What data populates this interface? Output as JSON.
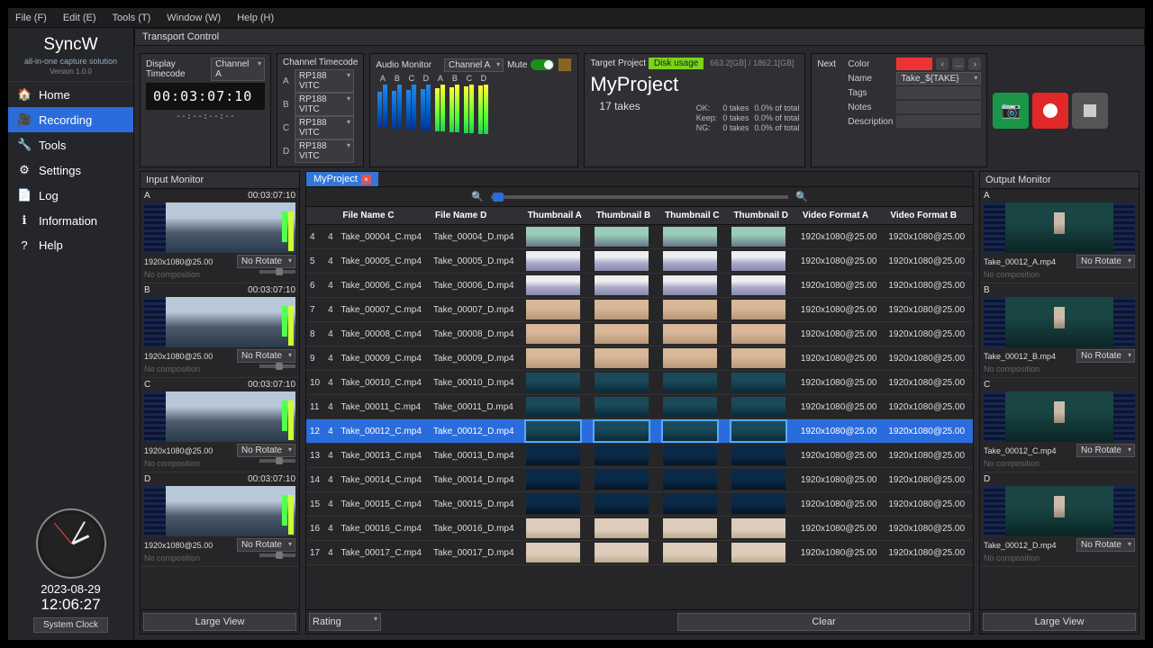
{
  "menu": [
    "File (F)",
    "Edit (E)",
    "Tools (T)",
    "Window (W)",
    "Help (H)"
  ],
  "brand": {
    "title": "SyncW",
    "sub": "all-in-one capture solution",
    "ver": "Version 1.0.0"
  },
  "nav": [
    {
      "label": "Home",
      "icon": "⮕",
      "glyph": "🏠"
    },
    {
      "label": "Recording",
      "icon": "🎥",
      "active": true
    },
    {
      "label": "Tools",
      "icon": "🔧"
    },
    {
      "label": "Settings",
      "icon": "⚙"
    },
    {
      "label": "Log",
      "icon": "📄"
    },
    {
      "label": "Information",
      "icon": "ℹ"
    },
    {
      "label": "Help",
      "icon": "?"
    }
  ],
  "clock": {
    "date": "2023-08-29",
    "time": "12:06:27",
    "btn": "System Clock"
  },
  "transport": {
    "hdr": "Transport Control"
  },
  "displayTC": {
    "label": "Display Timecode",
    "sel": "Channel A",
    "big": "00:03:07:10",
    "small": "--:--:--:--"
  },
  "chanTC": {
    "label": "Channel Timecode",
    "rows": [
      [
        "A",
        "RP188 VITC"
      ],
      [
        "B",
        "RP188 VITC"
      ],
      [
        "C",
        "RP188 VITC"
      ],
      [
        "D",
        "RP188 VITC"
      ]
    ]
  },
  "audio": {
    "label": "Audio Monitor",
    "sel": "Channel A",
    "mute": "Mute",
    "groups": [
      "A",
      "B",
      "C",
      "D",
      "A",
      "B",
      "C",
      "D"
    ]
  },
  "target": {
    "label": "Target Project",
    "disk": "Disk usage",
    "disktxt": "663.2[GB] / 1862.1[GB]",
    "name": "MyProject",
    "takes": "17 takes",
    "lbls": [
      "OK:",
      "Keep:",
      "NG:"
    ],
    "vals": [
      "0 takes",
      "0 takes",
      "0 takes"
    ],
    "pcts": [
      "0.0% of total",
      "0.0% of total",
      "0.0% of total"
    ]
  },
  "next": {
    "hdr": "Next",
    "fields": {
      "color": "Color",
      "name": "Name",
      "nameval": "Take_${TAKE}",
      "tags": "Tags",
      "notes": "Notes",
      "desc": "Description"
    }
  },
  "inputMon": {
    "hdr": "Input Monitor",
    "large": "Large View",
    "channels": [
      {
        "ch": "A",
        "tc": "00:03:07:10",
        "res": "1920x1080@25.00",
        "rot": "No Rotate",
        "comp": "No composition"
      },
      {
        "ch": "B",
        "tc": "00:03:07:10",
        "res": "1920x1080@25.00",
        "rot": "No Rotate",
        "comp": "No composition"
      },
      {
        "ch": "C",
        "tc": "00:03:07:10",
        "res": "1920x1080@25.00",
        "rot": "No Rotate",
        "comp": "No composition"
      },
      {
        "ch": "D",
        "tc": "00:03:07:10",
        "res": "1920x1080@25.00",
        "rot": "No Rotate",
        "comp": "No composition"
      }
    ]
  },
  "outputMon": {
    "hdr": "Output Monitor",
    "large": "Large View",
    "channels": [
      {
        "ch": "A",
        "file": "Take_00012_A.mp4",
        "rot": "No Rotate",
        "comp": "No composition"
      },
      {
        "ch": "B",
        "file": "Take_00012_B.mp4",
        "rot": "No Rotate",
        "comp": "No composition"
      },
      {
        "ch": "C",
        "file": "Take_00012_C.mp4",
        "rot": "No Rotate",
        "comp": "No composition"
      },
      {
        "ch": "D",
        "file": "Take_00012_D.mp4",
        "rot": "No Rotate",
        "comp": "No composition"
      }
    ]
  },
  "table": {
    "tab": "MyProject",
    "headers": [
      "",
      "",
      "File Name C",
      "File Name D",
      "Thumbnail A",
      "Thumbnail B",
      "Thumbnail C",
      "Thumbnail D",
      "Video Format A",
      "Video Format B"
    ],
    "rows": [
      {
        "n": 4,
        "r": 4,
        "fc": "Take_00004_C.mp4",
        "fd": "Take_00004_D.mp4",
        "th": "th-sky",
        "va": "1920x1080@25.00",
        "vb": "1920x1080@25.00"
      },
      {
        "n": 5,
        "r": 4,
        "fc": "Take_00005_C.mp4",
        "fd": "Take_00005_D.mp4",
        "th": "th-snow",
        "va": "1920x1080@25.00",
        "vb": "1920x1080@25.00"
      },
      {
        "n": 6,
        "r": 4,
        "fc": "Take_00006_C.mp4",
        "fd": "Take_00006_D.mp4",
        "th": "th-snow",
        "va": "1920x1080@25.00",
        "vb": "1920x1080@25.00"
      },
      {
        "n": 7,
        "r": 4,
        "fc": "Take_00007_C.mp4",
        "fd": "Take_00007_D.mp4",
        "th": "th-face",
        "va": "1920x1080@25.00",
        "vb": "1920x1080@25.00"
      },
      {
        "n": 8,
        "r": 4,
        "fc": "Take_00008_C.mp4",
        "fd": "Take_00008_D.mp4",
        "th": "th-face",
        "va": "1920x1080@25.00",
        "vb": "1920x1080@25.00"
      },
      {
        "n": 9,
        "r": 4,
        "fc": "Take_00009_C.mp4",
        "fd": "Take_00009_D.mp4",
        "th": "th-face",
        "va": "1920x1080@25.00",
        "vb": "1920x1080@25.00"
      },
      {
        "n": 10,
        "r": 4,
        "fc": "Take_00010_C.mp4",
        "fd": "Take_00010_D.mp4",
        "th": "th-div",
        "va": "1920x1080@25.00",
        "vb": "1920x1080@25.00"
      },
      {
        "n": 11,
        "r": 4,
        "fc": "Take_00011_C.mp4",
        "fd": "Take_00011_D.mp4",
        "th": "th-div",
        "va": "1920x1080@25.00",
        "vb": "1920x1080@25.00"
      },
      {
        "n": 12,
        "r": 4,
        "fc": "Take_00012_C.mp4",
        "fd": "Take_00012_D.mp4",
        "th": "th-div",
        "va": "1920x1080@25.00",
        "vb": "1920x1080@25.00",
        "sel": true
      },
      {
        "n": 13,
        "r": 4,
        "fc": "Take_00013_C.mp4",
        "fd": "Take_00013_D.mp4",
        "th": "th-nite",
        "va": "1920x1080@25.00",
        "vb": "1920x1080@25.00"
      },
      {
        "n": 14,
        "r": 4,
        "fc": "Take_00014_C.mp4",
        "fd": "Take_00014_D.mp4",
        "th": "th-nite",
        "va": "1920x1080@25.00",
        "vb": "1920x1080@25.00"
      },
      {
        "n": 15,
        "r": 4,
        "fc": "Take_00015_C.mp4",
        "fd": "Take_00015_D.mp4",
        "th": "th-nite",
        "va": "1920x1080@25.00",
        "vb": "1920x1080@25.00"
      },
      {
        "n": 16,
        "r": 4,
        "fc": "Take_00016_C.mp4",
        "fd": "Take_00016_D.mp4",
        "th": "th-dez",
        "va": "1920x1080@25.00",
        "vb": "1920x1080@25.00"
      },
      {
        "n": 17,
        "r": 4,
        "fc": "Take_00017_C.mp4",
        "fd": "Take_00017_D.mp4",
        "th": "th-dez",
        "va": "1920x1080@25.00",
        "vb": "1920x1080@25.00"
      }
    ],
    "rating": "Rating",
    "clear": "Clear"
  }
}
